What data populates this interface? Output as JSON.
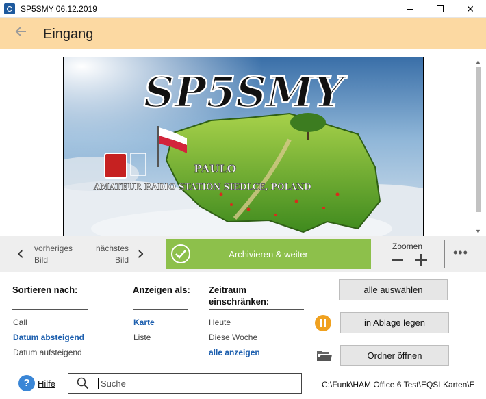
{
  "window": {
    "title": "SP5SMY 06.12.2019",
    "minimize_label": "–",
    "maximize_label": "□",
    "close_label": "✕"
  },
  "header": {
    "back_icon": "arrow-left-icon",
    "title": "Eingang"
  },
  "image": {
    "caption_main": "SP5SMY",
    "caption_name": "PAULO",
    "caption_sub": "AMATEUR RADIO STATION SIEDLCE, POLAND"
  },
  "toolbar": {
    "prev_line1": "vorheriges",
    "prev_line2": "Bild",
    "next_line1": "nächstes",
    "next_line2": "Bild",
    "archive_label": "Archivieren & weiter",
    "zoom_label": "Zoomen",
    "more_label": "•••",
    "accent_color": "#8dc04b"
  },
  "options": {
    "sort": {
      "heading": "Sortieren nach:",
      "items": [
        "Call",
        "Datum absteigend",
        "Datum aufsteigend"
      ],
      "selected": "Datum absteigend"
    },
    "display": {
      "heading": "Anzeigen als:",
      "items": [
        "Karte",
        "Liste"
      ],
      "selected": "Karte"
    },
    "range": {
      "heading_line1": "Zeitraum",
      "heading_line2": "einschränken:",
      "items": [
        "Heute",
        "Diese Woche",
        "alle anzeigen"
      ],
      "selected": "alle anzeigen"
    },
    "select_color": "#1d5fae"
  },
  "actions": {
    "select_all": "alle auswählen",
    "put_aside": "in Ablage legen",
    "open_folder": "Ordner öffnen"
  },
  "bottom": {
    "help_icon": "?",
    "help_label": "Hilfe",
    "search_placeholder": "Suche",
    "path": "C:\\Funk\\HAM Office 6 Test\\EQSLKarten\\E"
  }
}
